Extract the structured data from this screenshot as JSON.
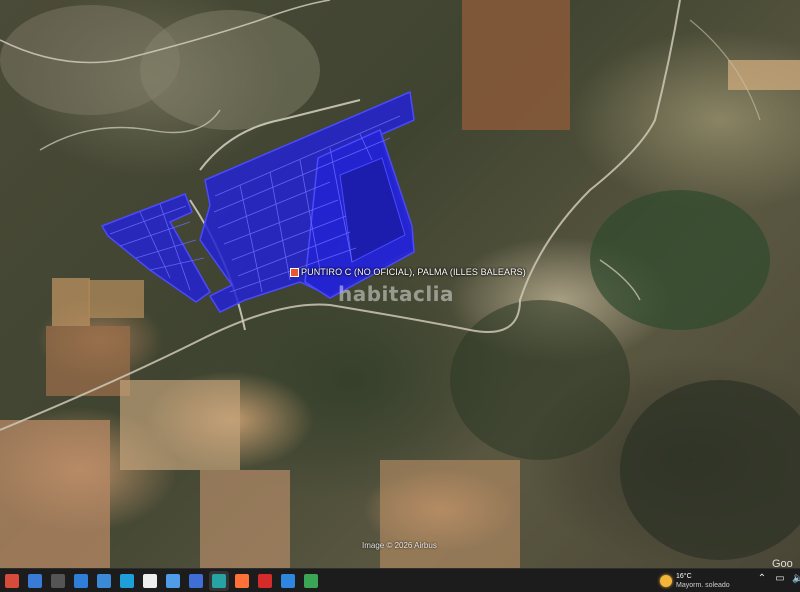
{
  "map": {
    "marker_label": "PUNTIRO C (NO OFICIAL), PALMA (ILLES BALEARS)",
    "watermark": "habitaclia",
    "copyright": "Image © 2026 Airbus",
    "brand": "Goo"
  },
  "colors": {
    "parcel_fill": "#2323d4",
    "parcel_line": "#4a4aff",
    "marker": "#e8582a"
  },
  "taskbar": {
    "apps": [
      {
        "icon": "chrome-icon",
        "color": "#d64b3b"
      },
      {
        "icon": "store-icon",
        "color": "#3a7bd5"
      },
      {
        "icon": "media-icon",
        "color": "#555555"
      },
      {
        "icon": "explorer-icon",
        "color": "#2f7fd8"
      },
      {
        "icon": "photos-icon",
        "color": "#3b8ad8"
      },
      {
        "icon": "edge-icon",
        "color": "#1e9fd9"
      },
      {
        "icon": "file-icon",
        "color": "#eeeeee"
      },
      {
        "icon": "maps-icon",
        "color": "#4f9de8"
      },
      {
        "icon": "save-icon",
        "color": "#3f6fd6"
      },
      {
        "icon": "teams-icon",
        "color": "#27a3a3"
      },
      {
        "icon": "firefox-icon",
        "color": "#ff7139"
      },
      {
        "icon": "acrobat-icon",
        "color": "#d62b2b"
      },
      {
        "icon": "s-app-icon",
        "color": "#2e86de"
      },
      {
        "icon": "media-player-icon",
        "color": "#3aa655"
      }
    ],
    "weather": {
      "temperature": "16°C",
      "condition": "Mayorm. soleado"
    }
  }
}
